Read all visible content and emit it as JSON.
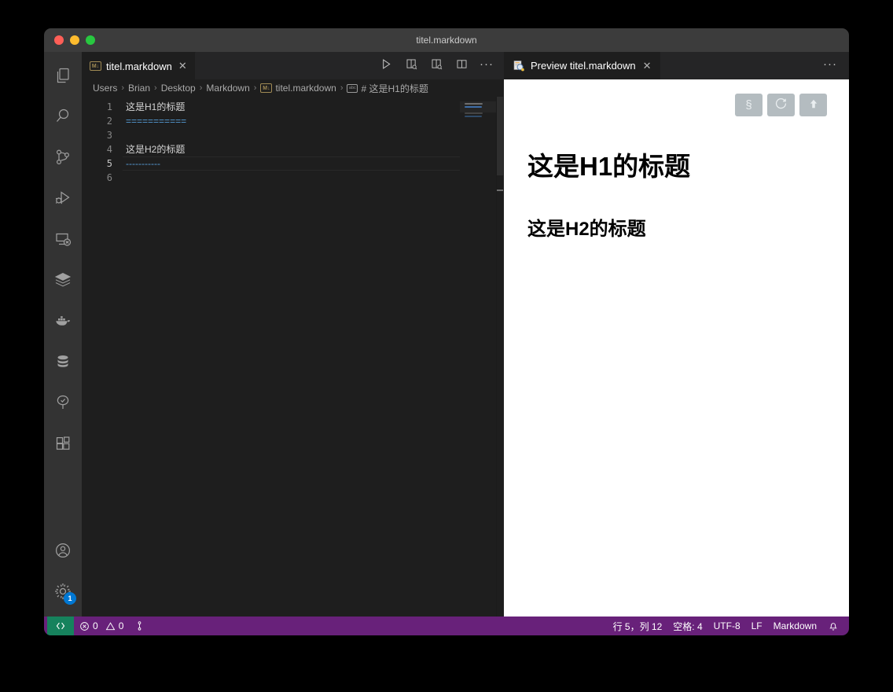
{
  "window": {
    "title": "titel.markdown",
    "traffic_lights": [
      "close-red",
      "minimize-yellow",
      "maximize-green"
    ]
  },
  "activity_bar": {
    "items": [
      {
        "name": "explorer",
        "icon": "files-icon"
      },
      {
        "name": "search",
        "icon": "search-icon"
      },
      {
        "name": "source-control",
        "icon": "source-control-icon"
      },
      {
        "name": "run-and-debug",
        "icon": "run-debug-icon"
      },
      {
        "name": "remote-explorer",
        "icon": "remote-explorer-icon"
      },
      {
        "name": "layers",
        "icon": "layers-icon"
      },
      {
        "name": "docker",
        "icon": "docker-whale-icon"
      },
      {
        "name": "database",
        "icon": "database-icon"
      },
      {
        "name": "testing",
        "icon": "tree-check-icon"
      },
      {
        "name": "extensions",
        "icon": "extensions-icon"
      }
    ],
    "bottom_items": [
      {
        "name": "accounts",
        "icon": "account-icon",
        "badge": ""
      },
      {
        "name": "manage",
        "icon": "gear-icon",
        "badge": "1"
      }
    ],
    "badge_color": "#0078d4"
  },
  "editor": {
    "tab": {
      "label": "titel.markdown",
      "icon_label": "M↓",
      "close_label": "✕"
    },
    "actions": [
      {
        "name": "run-code",
        "icon": "play-icon"
      },
      {
        "name": "open-preview-to-the-side",
        "icon": "preview-side-icon"
      },
      {
        "name": "open-locked-preview-to-the-side",
        "icon": "preview-side-locked-icon"
      },
      {
        "name": "split-editor-right",
        "icon": "split-editor-icon"
      },
      {
        "name": "more-actions",
        "icon": "ellipsis-icon"
      }
    ],
    "breadcrumbs": [
      {
        "label": "Users",
        "icon": ""
      },
      {
        "label": "Brian",
        "icon": ""
      },
      {
        "label": "Desktop",
        "icon": ""
      },
      {
        "label": "Markdown",
        "icon": ""
      },
      {
        "label": "titel.markdown",
        "icon": "markdown-file-icon"
      },
      {
        "label": "# 这是H1的标题",
        "icon": "abc-symbol-icon"
      }
    ],
    "breadcrumb_separator": "›",
    "line_numbers": [
      "1",
      "2",
      "3",
      "4",
      "5",
      "6"
    ],
    "active_line_index": 4,
    "lines": [
      {
        "text": "这是H1的标题",
        "type": "heading"
      },
      {
        "text": "===========",
        "type": "rule"
      },
      {
        "text": "",
        "type": "blank"
      },
      {
        "text": "这是H2的标题",
        "type": "heading"
      },
      {
        "text": "-----------",
        "type": "rule"
      },
      {
        "text": "",
        "type": "blank"
      }
    ],
    "rule_color": "#569cd6",
    "text_color": "#d4d4d4"
  },
  "preview": {
    "tab": {
      "label": "Preview titel.markdown",
      "close_label": "✕",
      "icon": "markdown-preview-icon"
    },
    "more_actions_label": "···",
    "toolbar": [
      {
        "name": "section-symbol-button",
        "glyph": "§"
      },
      {
        "name": "refresh-button",
        "glyph": "⟳"
      },
      {
        "name": "scroll-to-top-button",
        "glyph": "⬆"
      }
    ],
    "toolbar_color": "#b4bcc0",
    "h1": "这是H1的标题",
    "h2": "这是H2的标题"
  },
  "status_bar": {
    "background": "#68217a",
    "remote": {
      "label": "",
      "icon": "remote-window-icon",
      "color": "#16825d"
    },
    "problems": {
      "errors": "0",
      "warnings": "0"
    },
    "source_control": {
      "icon": "git-branch-icon",
      "label": ""
    },
    "right_items": [
      {
        "name": "cursor-position",
        "label": "行 5，列 12"
      },
      {
        "name": "indentation",
        "label": "空格: 4"
      },
      {
        "name": "encoding",
        "label": "UTF-8"
      },
      {
        "name": "eol",
        "label": "LF"
      },
      {
        "name": "language-mode",
        "label": "Markdown"
      },
      {
        "name": "notifications",
        "label": "",
        "icon": "bell-icon"
      }
    ]
  }
}
